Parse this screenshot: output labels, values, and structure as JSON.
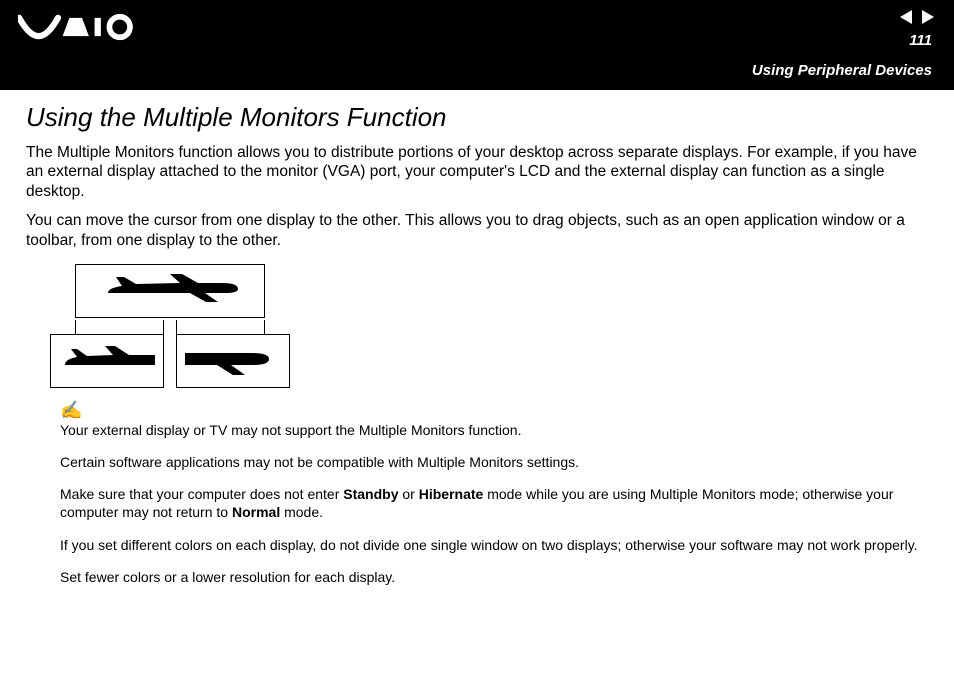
{
  "header": {
    "page_number": "111",
    "section": "Using Peripheral Devices"
  },
  "heading": "Using the Multiple Monitors Function",
  "para1": "The Multiple Monitors function allows you to distribute portions of your desktop across separate displays. For example, if you have an external display attached to the monitor (VGA) port, your computer's LCD and the external display can function as a single desktop.",
  "para2": "You can move the cursor from one display to the other. This allows you to drag objects, such as an open application window or a toolbar, from one display to the other.",
  "notes": {
    "n1": "Your external display or TV may not support the Multiple Monitors function.",
    "n2": "Certain software applications may not be compatible with Multiple Monitors settings.",
    "n3a": "Make sure that your computer does not enter ",
    "n3_standby": "Standby",
    "n3b": " or ",
    "n3_hibernate": "Hibernate",
    "n3c": " mode while you are using Multiple Monitors mode; otherwise your computer may not return to ",
    "n3_normal": "Normal",
    "n3d": " mode.",
    "n4": "If you set different colors on each display, do not divide one single window on two displays; otherwise your software may not work properly.",
    "n5": "Set fewer colors or a lower resolution for each display."
  }
}
